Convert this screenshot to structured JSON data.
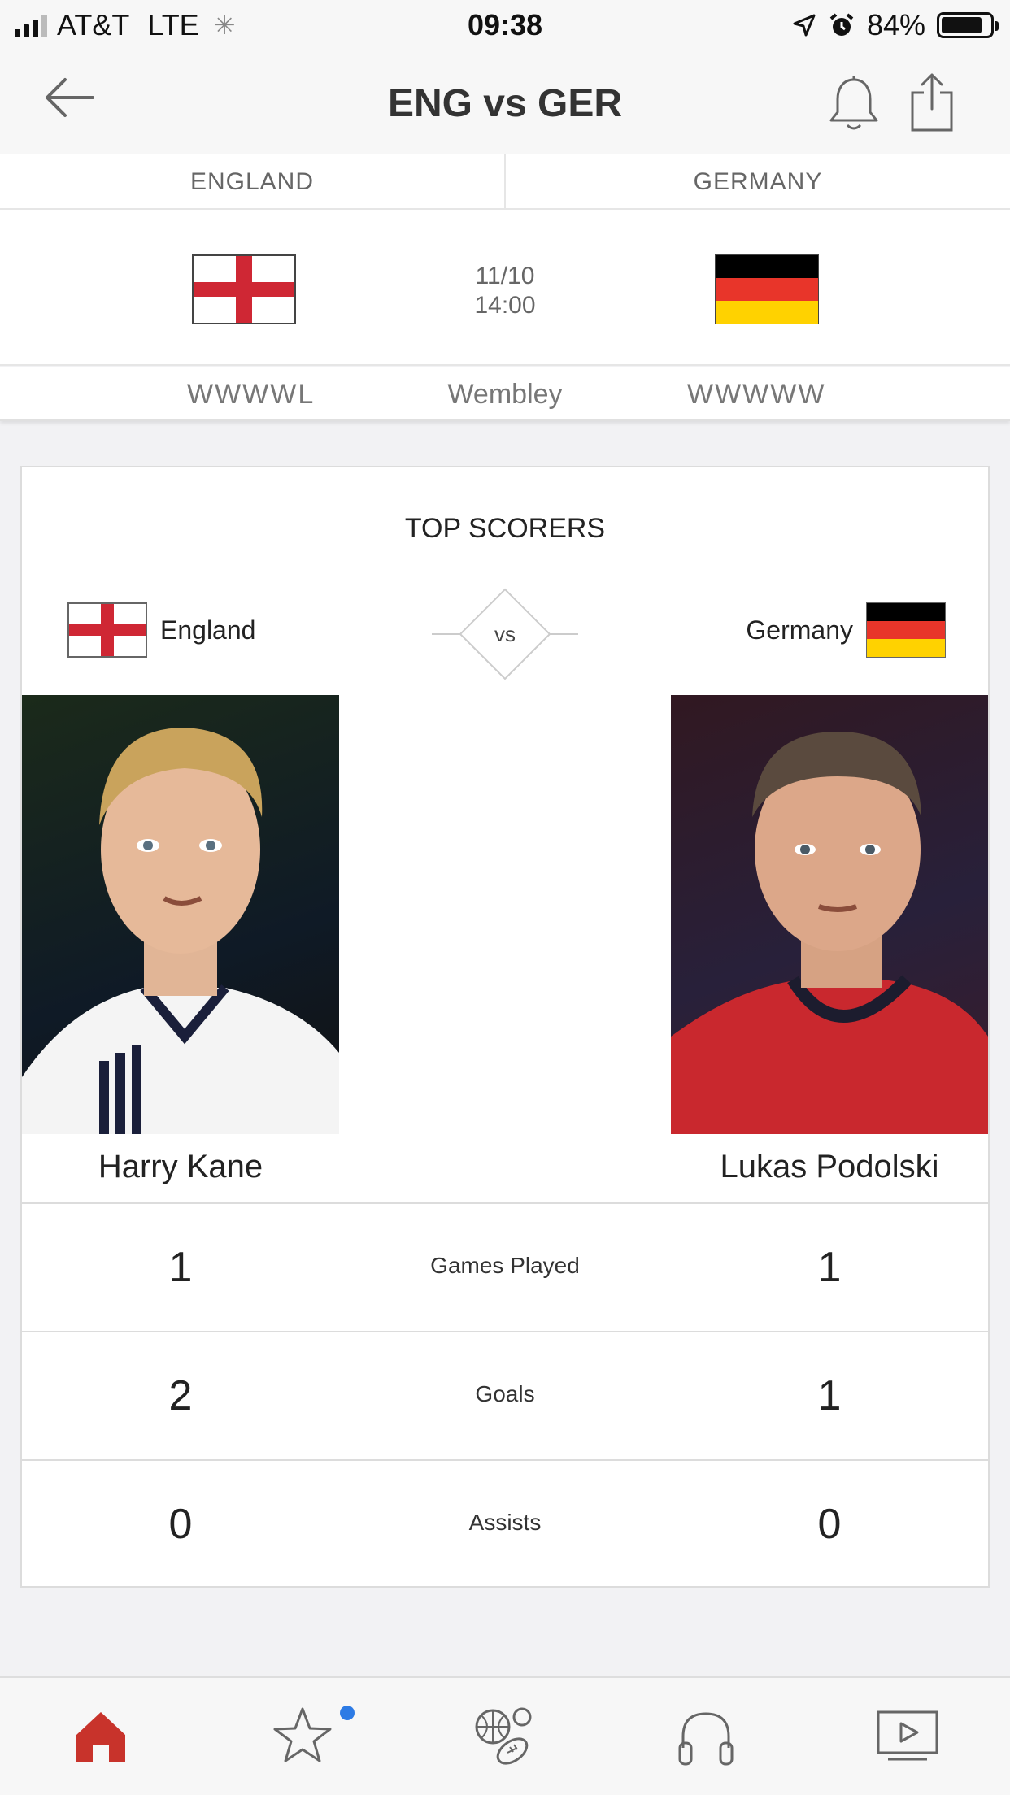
{
  "status_bar": {
    "carrier": "AT&T",
    "network": "LTE",
    "time": "09:38",
    "battery": "84%",
    "battery_level": 0.84
  },
  "nav": {
    "title": "ENG vs GER"
  },
  "match": {
    "home_team": "ENGLAND",
    "away_team": "GERMANY",
    "date": "11/10",
    "time": "14:00",
    "home_form": "WWWWL",
    "venue": "Wembley",
    "away_form": "WWWWW"
  },
  "top_scorers": {
    "title": "TOP SCORERS",
    "home_label": "England",
    "away_label": "Germany",
    "vs": "vs",
    "home_player": "Harry Kane",
    "away_player": "Lukas Podolski",
    "stats": [
      {
        "label": "Games Played",
        "home": "1",
        "away": "1"
      },
      {
        "label": "Goals",
        "home": "2",
        "away": "1"
      },
      {
        "label": "Assists",
        "home": "0",
        "away": "0"
      }
    ]
  },
  "tabs": [
    {
      "name": "home",
      "icon": "home-icon",
      "active": true
    },
    {
      "name": "favorites",
      "icon": "star-icon",
      "badge": true
    },
    {
      "name": "sports",
      "icon": "sports-balls-icon"
    },
    {
      "name": "audio",
      "icon": "headphones-icon"
    },
    {
      "name": "video",
      "icon": "video-play-icon"
    }
  ],
  "colors": {
    "accent_red": "#c8332b",
    "badge_blue": "#2d7be5",
    "eng_cross": "#cf2734",
    "ger_black": "#000000",
    "ger_red": "#e8352a",
    "ger_gold": "#ffd200"
  }
}
